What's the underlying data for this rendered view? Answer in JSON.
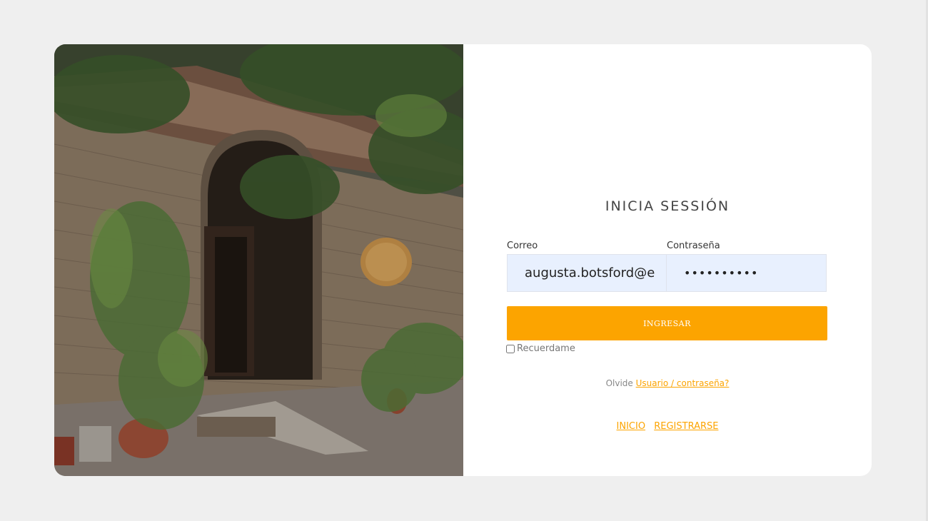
{
  "login": {
    "title": "INICIA SESSIÓN",
    "email_label": "Correo",
    "password_label": "Contraseña",
    "email_value": "augusta.botsford@e",
    "password_value": "••••••••••",
    "submit_label": "INGRESAR",
    "remember_label": "Recuerdame",
    "forgot_prefix": "Olvide",
    "forgot_link": "Usuario / contraseña?",
    "nav_links": [
      "INICIO",
      "REGISTRARSE"
    ]
  },
  "colors": {
    "accent": "#fca400",
    "input_bg": "#e8f0fe",
    "page_bg": "#efefef"
  }
}
